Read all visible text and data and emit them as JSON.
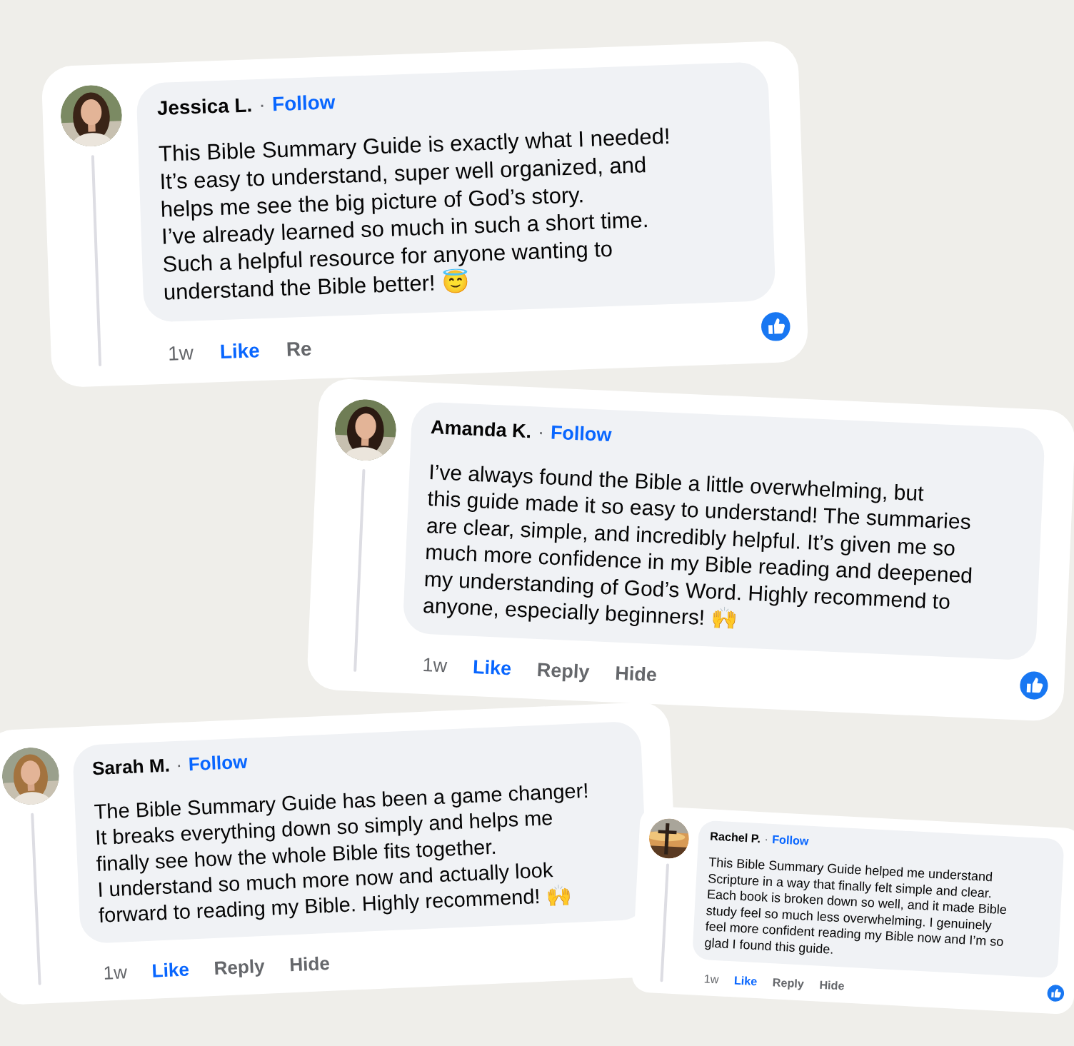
{
  "comments": [
    {
      "name": "Jessica L.",
      "separator": "·",
      "follow": "Follow",
      "text": "This Bible Summary Guide is exactly what I needed!\nIt’s easy to understand, super well organized, and\nhelps me see the big picture of God’s story.\nI’ve already learned so much in such a short time.\nSuch a helpful resource for anyone wanting to\nunderstand the Bible better! 😇",
      "actions": [
        {
          "kind": "time",
          "label": "1w"
        },
        {
          "kind": "like",
          "label": "Like",
          "selected": true
        },
        {
          "kind": "plain",
          "label": "Re"
        }
      ],
      "reaction": true
    },
    {
      "name": "Amanda K.",
      "separator": "·",
      "follow": "Follow",
      "text": "I’ve always found the Bible a little overwhelming, but\nthis guide made it so easy to understand! The summaries\nare clear, simple, and incredibly helpful. It’s given me so\nmuch more confidence in my Bible reading and deepened\nmy understanding of God’s Word. Highly recommend to\nanyone, especially beginners! 🙌",
      "actions": [
        {
          "kind": "time",
          "label": "1w"
        },
        {
          "kind": "like",
          "label": "Like",
          "selected": true
        },
        {
          "kind": "plain",
          "label": "Reply"
        },
        {
          "kind": "plain",
          "label": "Hide"
        }
      ],
      "reaction": true
    },
    {
      "name": "Sarah M.",
      "separator": "·",
      "follow": "Follow",
      "text": "The Bible Summary Guide has been a game changer!\nIt breaks everything down so simply and helps me\nfinally see how the whole Bible fits together.\nI understand so much more now and actually look\nforward to reading my Bible. Highly recommend! 🙌",
      "actions": [
        {
          "kind": "time",
          "label": "1w"
        },
        {
          "kind": "like",
          "label": "Like",
          "selected": true
        },
        {
          "kind": "plain",
          "label": "Reply"
        },
        {
          "kind": "plain",
          "label": "Hide"
        }
      ],
      "reaction": false
    },
    {
      "name": "Rachel P.",
      "separator": "·",
      "follow": "Follow",
      "text": "This Bible Summary Guide helped me understand\nScripture in a way that finally felt simple and clear.\nEach book is broken down so well, and it made Bible\nstudy feel so much less overwhelming. I genuinely\nfeel more confident reading my Bible now and I’m so\nglad I found this guide.",
      "actions": [
        {
          "kind": "time",
          "label": "1w"
        },
        {
          "kind": "like",
          "label": "Like",
          "selected": true
        },
        {
          "kind": "plain",
          "label": "Reply"
        },
        {
          "kind": "plain",
          "label": "Hide"
        }
      ],
      "reaction": true
    }
  ]
}
